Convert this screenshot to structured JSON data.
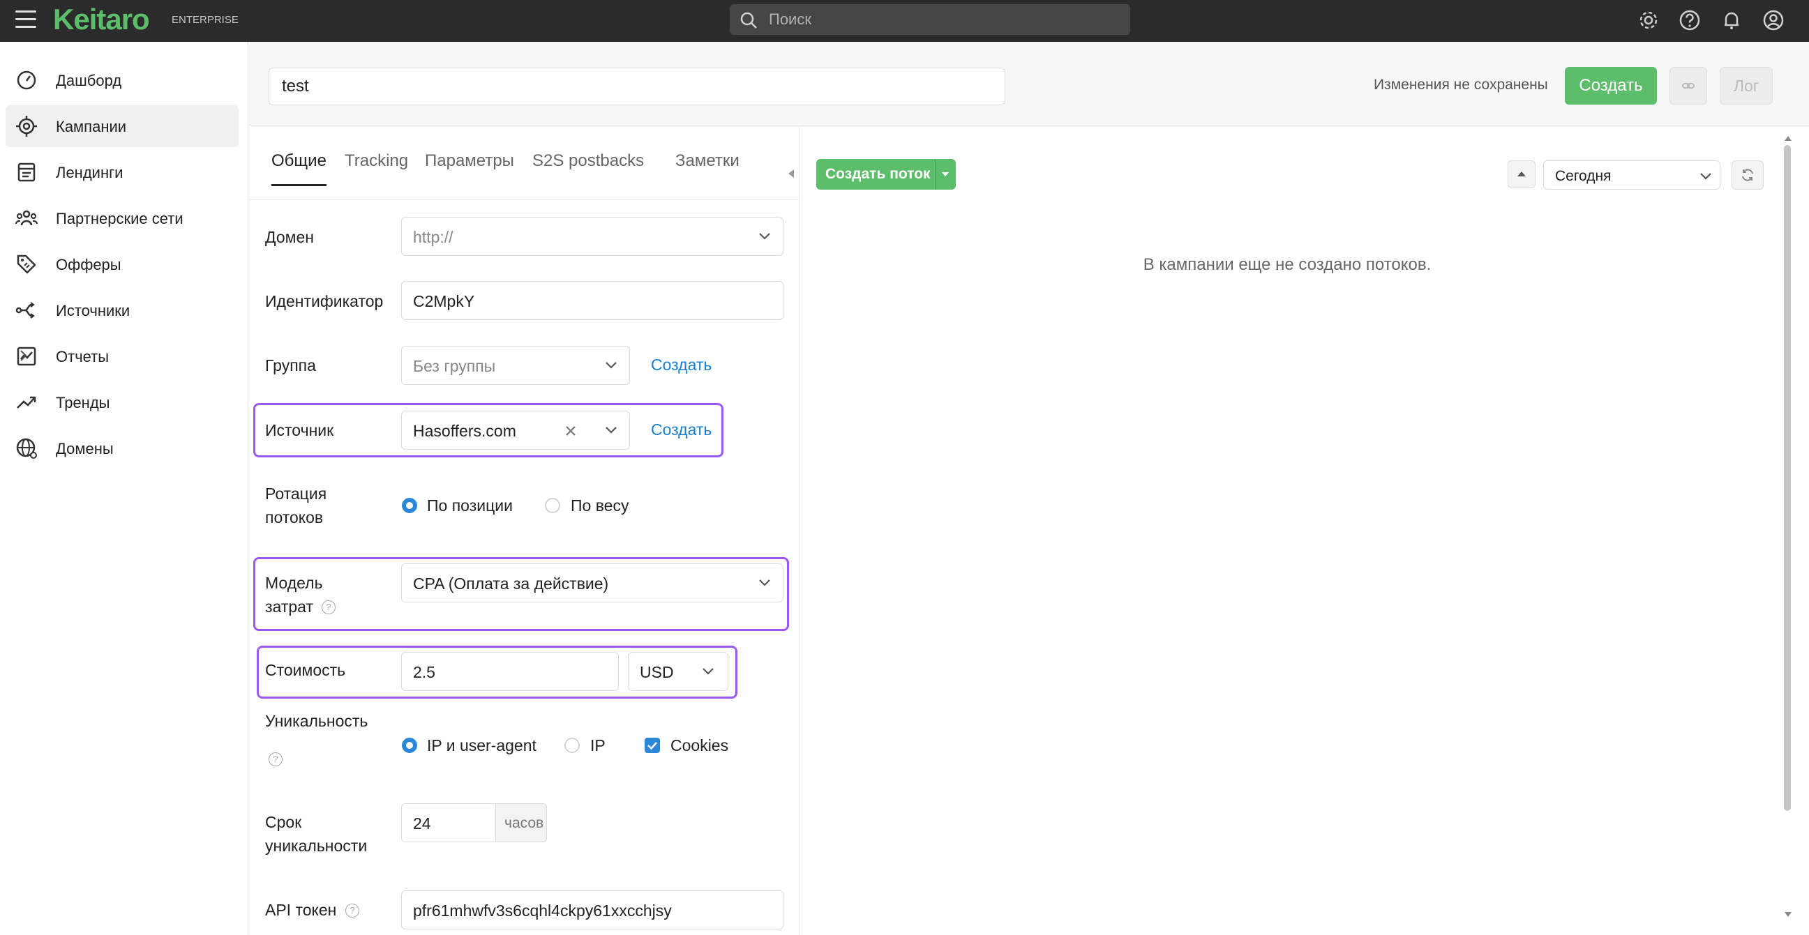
{
  "app": {
    "logo": "Keitaro",
    "edition": "ENTERPRISE",
    "search_placeholder": "Поиск"
  },
  "topbar_icons": [
    "gear-icon",
    "help-icon",
    "bell-icon",
    "user-icon"
  ],
  "sidebar": {
    "items": [
      {
        "label": "Дашборд",
        "icon": "dashboard-icon"
      },
      {
        "label": "Кампании",
        "icon": "target-icon",
        "active": true
      },
      {
        "label": "Лендинги",
        "icon": "landing-icon"
      },
      {
        "label": "Партнерские сети",
        "icon": "people-icon"
      },
      {
        "label": "Офферы",
        "icon": "tag-icon"
      },
      {
        "label": "Источники",
        "icon": "source-icon"
      },
      {
        "label": "Отчеты",
        "icon": "report-icon",
        "has_submenu": true
      },
      {
        "label": "Тренды",
        "icon": "trend-icon"
      },
      {
        "label": "Домены",
        "icon": "globe-icon"
      }
    ]
  },
  "header": {
    "campaign_name": "test",
    "unsaved_text": "Изменения не сохранены",
    "create_label": "Создать",
    "log_label": "Лог"
  },
  "tabs": [
    "Общие",
    "Tracking",
    "Параметры",
    "S2S postbacks",
    "Заметки"
  ],
  "form": {
    "domain": {
      "label": "Домен",
      "value": "http://"
    },
    "identifier": {
      "label": "Идентификатор",
      "value": "C2MpkY"
    },
    "group": {
      "label": "Группа",
      "value": "Без группы",
      "create": "Создать"
    },
    "source": {
      "label": "Источник",
      "value": "Hasoffers.com",
      "create": "Создать"
    },
    "rotation": {
      "label_1": "Ротация",
      "label_2": "потоков",
      "options": [
        "По позиции",
        "По весу"
      ],
      "selected": 0
    },
    "cost_model": {
      "label_1": "Модель",
      "label_2": "затрат",
      "value": "CPA (Оплата за действие)"
    },
    "cost": {
      "label": "Стоимость",
      "value": "2.5",
      "currency": "USD"
    },
    "uniqueness": {
      "label": "Уникальность",
      "options": [
        "IP и user-agent",
        "IP"
      ],
      "selected": 0,
      "cookies": "Cookies"
    },
    "uniq_period": {
      "label_1": "Срок",
      "label_2": "уникальности",
      "value": "24",
      "unit": "часов"
    },
    "api_token": {
      "label": "API токен",
      "value": "pfr61mhwfv3s6cqhl4ckpy61xxcchjsy"
    }
  },
  "streams": {
    "create_label": "Создать поток",
    "period": "Сегодня",
    "empty_message": "В кампании еще не создано потоков."
  }
}
